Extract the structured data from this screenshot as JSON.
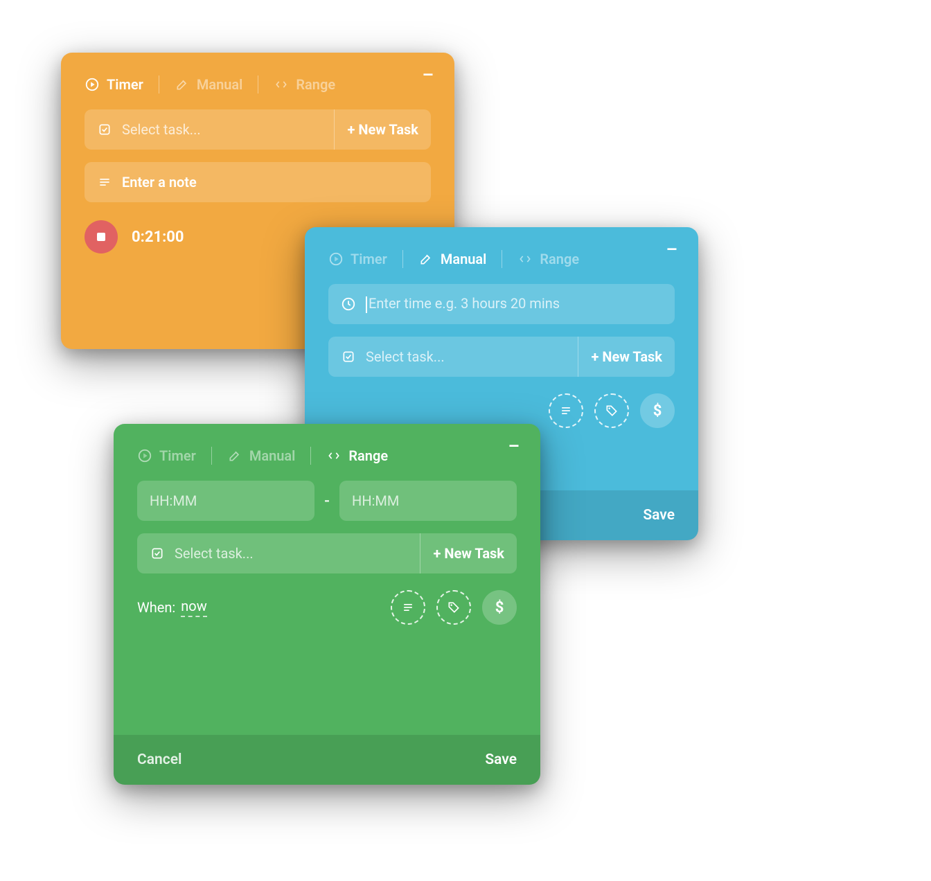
{
  "tabs": {
    "timer": "Timer",
    "manual": "Manual",
    "range": "Range"
  },
  "common": {
    "select_task_placeholder": "Select task...",
    "new_task_button": "+ New Task",
    "cancel": "Cancel",
    "save": "Save",
    "minimize": "–"
  },
  "orange": {
    "active_tab": "timer",
    "note_placeholder": "Enter a note",
    "timer_value": "0:21:00"
  },
  "blue": {
    "active_tab": "manual",
    "time_placeholder": "Enter time e.g. 3 hours 20 mins"
  },
  "green": {
    "active_tab": "range",
    "time_from_placeholder": "HH:MM",
    "time_to_placeholder": "HH:MM",
    "when_label": "When:",
    "when_value": "now"
  },
  "icons": {
    "note": "note-icon",
    "tag": "tag-icon",
    "billable": "dollar-icon"
  },
  "colors": {
    "orange": "#f2a941",
    "blue": "#4bbbdb",
    "green": "#51b25f",
    "stop_button": "#e16262"
  }
}
